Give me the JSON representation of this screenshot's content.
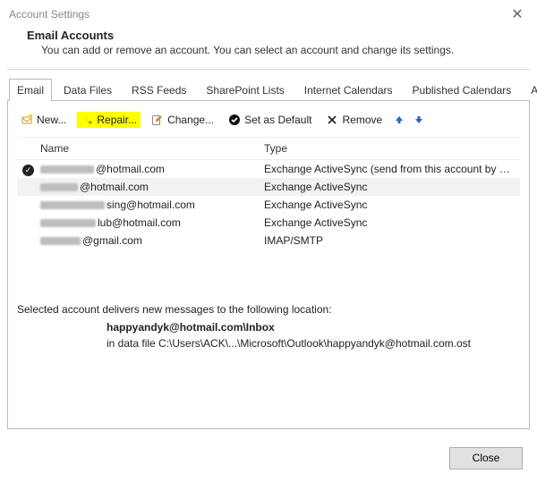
{
  "window": {
    "title": "Account Settings"
  },
  "header": {
    "title": "Email Accounts",
    "subtitle": "You can add or remove an account. You can select an account and change its settings."
  },
  "tabs": [
    "Email",
    "Data Files",
    "RSS Feeds",
    "SharePoint Lists",
    "Internet Calendars",
    "Published Calendars",
    "Address Books"
  ],
  "toolbar": {
    "new": "New...",
    "repair": "Repair...",
    "change": "Change...",
    "default": "Set as Default",
    "remove": "Remove"
  },
  "grid": {
    "col_name": "Name",
    "col_type": "Type",
    "rows": [
      {
        "suffix": "@hotmail.com",
        "type": "Exchange ActiveSync (send from this account by def...",
        "default": true,
        "selected": false
      },
      {
        "suffix": "@hotmail.com",
        "type": "Exchange ActiveSync",
        "default": false,
        "selected": true
      },
      {
        "suffix": "sing@hotmail.com",
        "type": "Exchange ActiveSync",
        "default": false,
        "selected": false
      },
      {
        "suffix": "lub@hotmail.com",
        "type": "Exchange ActiveSync",
        "default": false,
        "selected": false
      },
      {
        "suffix": "@gmail.com",
        "type": "IMAP/SMTP",
        "default": false,
        "selected": false
      }
    ]
  },
  "location": {
    "intro": "Selected account delivers new messages to the following location:",
    "bold": "happyandyk@hotmail.com\\Inbox",
    "path": "in data file C:\\Users\\ACK\\...\\Microsoft\\Outlook\\happyandyk@hotmail.com.ost"
  },
  "footer": {
    "close": "Close"
  }
}
